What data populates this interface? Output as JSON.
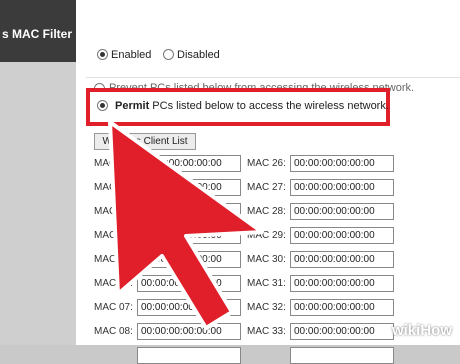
{
  "page": {
    "title": "s MAC Filter"
  },
  "mode": {
    "enabled_label": "Enabled",
    "disabled_label": "Disabled"
  },
  "rules": {
    "prevent_label": "Prevent PCs listed below from accessing the wireless network.",
    "permit_bold": "Permit",
    "permit_rest": " PCs listed below to access the wireless network."
  },
  "wireless_client_button": "Wireless Client List",
  "mac_rows": [
    {
      "left_label": "MAC",
      "left_value": "00:00:00:00:00:00",
      "right_label": "MAC 26:",
      "right_value": "00:00:00:00:00:00"
    },
    {
      "left_label": "MAC",
      "left_value": "00:00:00:00:00:00",
      "right_label": "MAC 27:",
      "right_value": "00:00:00:00:00:00"
    },
    {
      "left_label": "MAC 03",
      "left_value": "00:00:00:00:00:00",
      "right_label": "MAC 28:",
      "right_value": "00:00:00:00:00:00"
    },
    {
      "left_label": "MAC 04",
      "left_value": "00:00:00:00:00:00",
      "right_label": "MAC 29:",
      "right_value": "00:00:00:00:00:00"
    },
    {
      "left_label": "MAC 05:",
      "left_value": "00:00:00:00:00:00",
      "right_label": "MAC 30:",
      "right_value": "00:00:00:00:00:00"
    },
    {
      "left_label": "MAC 06:",
      "left_value": "00:00:00:00:00:00",
      "right_label": "MAC 31:",
      "right_value": "00:00:00:00:00:00"
    },
    {
      "left_label": "MAC 07:",
      "left_value": "00:00:00:00:00:00",
      "right_label": "MAC 32:",
      "right_value": "00:00:00:00:00:00"
    },
    {
      "left_label": "MAC 08:",
      "left_value": "00:00:00:00:00:00",
      "right_label": "MAC 33:",
      "right_value": "00:00:00:00:00:00"
    },
    {
      "left_label": "",
      "left_value": "",
      "right_label": "",
      "right_value": ""
    }
  ],
  "watermark": {
    "wiki": "wiki",
    "how": "How"
  },
  "colors": {
    "highlight": "#e01f2a",
    "arrow_fill": "#e01f2a",
    "arrow_stroke": "#ffffff"
  }
}
